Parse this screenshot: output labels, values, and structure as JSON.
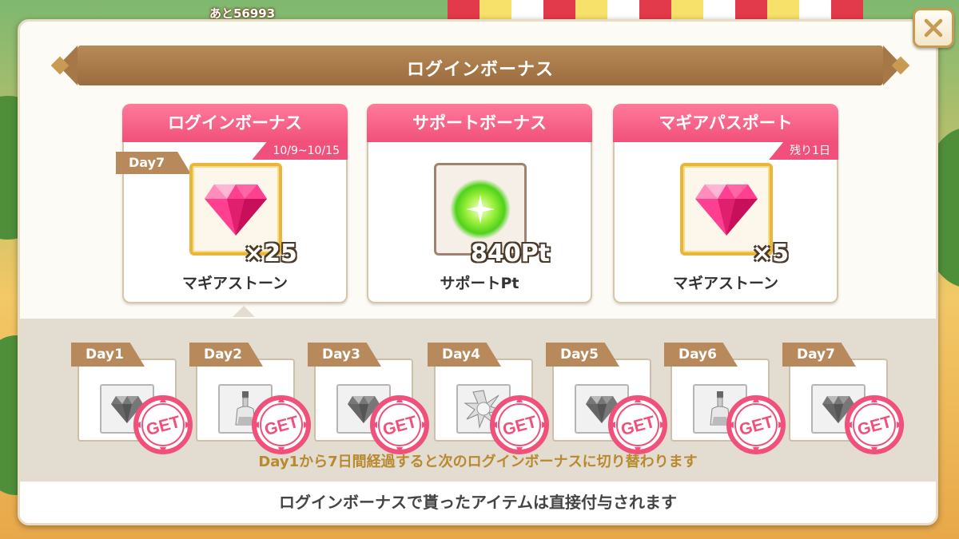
{
  "background": {
    "counter_text": "あと56993"
  },
  "dialog": {
    "title": "ログインボーナス",
    "close_label": "✕"
  },
  "cards": [
    {
      "header": "ログインボーナス",
      "subtitle": "10/9~10/15",
      "day_tag": "Day7",
      "item_icon": "magia-stone-icon",
      "quantity": "×25",
      "item_name": "マギアストーン"
    },
    {
      "header": "サポートボーナス",
      "item_icon": "support-point-icon",
      "quantity": "840Pt",
      "item_name": "サポートPt"
    },
    {
      "header": "マギアパスポート",
      "subtitle": "残り1日",
      "item_icon": "magia-stone-icon",
      "quantity": "×5",
      "item_name": "マギアストーン"
    }
  ],
  "days": [
    {
      "label": "Day1",
      "icon": "gray-gem-icon",
      "stamp": "GET"
    },
    {
      "label": "Day2",
      "icon": "potion-bottle-icon",
      "stamp": "GET"
    },
    {
      "label": "Day3",
      "icon": "gray-gem-icon",
      "stamp": "GET"
    },
    {
      "label": "Day4",
      "icon": "spark-burst-icon",
      "stamp": "GET"
    },
    {
      "label": "Day5",
      "icon": "gray-gem-icon",
      "stamp": "GET"
    },
    {
      "label": "Day6",
      "icon": "potion-bottle-icon",
      "stamp": "GET"
    },
    {
      "label": "Day7",
      "icon": "gray-gem-icon",
      "stamp": "GET"
    }
  ],
  "info_text": "Day1から7日間経過すると次のログインボーナスに切り替わります",
  "footer_text": "ログインボーナスで貰ったアイテムは直接付与されます",
  "colors": {
    "pink": "#f0507a",
    "brown": "#b8895a",
    "gold": "#e9b53a"
  }
}
